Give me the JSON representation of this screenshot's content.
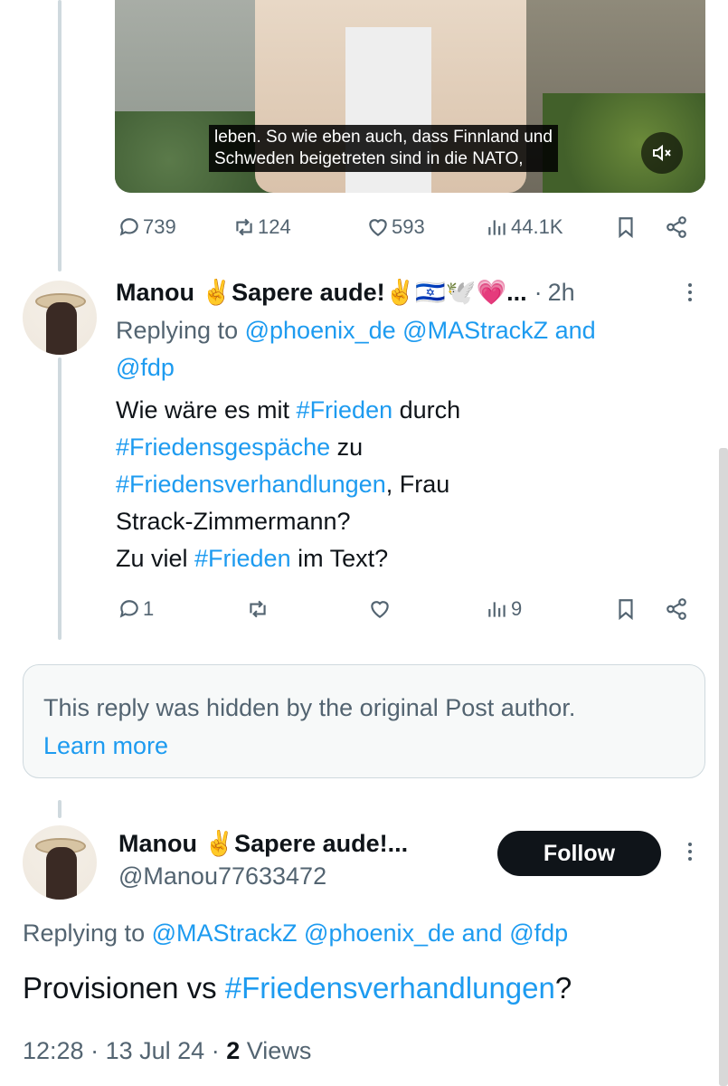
{
  "video": {
    "subtitle_line1": "leben. So wie eben auch, dass Finnland und",
    "subtitle_line2": "Schweden beigetreten sind in die NATO,"
  },
  "main_post_actions": {
    "replies": "739",
    "reposts": "124",
    "likes": "593",
    "views": "44.1K"
  },
  "reply1": {
    "display_name": "Manou ✌️Sapere aude!✌️🇮🇱🕊️💗...",
    "separator": "·",
    "time": "2h",
    "replying_prefix": "Replying to",
    "mention1": "@phoenix_de",
    "mention2": "@MAStrackZ",
    "and_word": "and",
    "mention3": "@fdp",
    "t1": "Wie wäre es mit ",
    "h1": "#Frieden",
    "t2": " durch",
    "h2": "#Friedensgespäche",
    "t3": " zu",
    "h3": "#Friedensverhandlungen",
    "t4": ", Frau",
    "t5": "Strack-Zimmermann?",
    "t6": "Zu viel ",
    "h4": "#Frieden",
    "t7": " im Text?",
    "actions": {
      "replies": "1",
      "views": "9"
    }
  },
  "hidden_notice": {
    "text": "This reply was hidden by the original Post author.",
    "link": "Learn more"
  },
  "reply2": {
    "display_name": "Manou ✌️Sapere aude!...",
    "handle": "@Manou77633472",
    "follow_label": "Follow",
    "replying_prefix": "Replying to",
    "mention1": "@MAStrackZ",
    "mention2": "@phoenix_de",
    "and_word": "and",
    "mention3": "@fdp",
    "t1": "Provisionen vs ",
    "h1": "#Friedensverhandlungen",
    "t2": "?",
    "time": "12:28",
    "sep1": "·",
    "date": "13 Jul 24",
    "sep2": "·",
    "views_count": "2",
    "views_label": "Views"
  },
  "colors": {
    "accent": "#1d9bf0",
    "muted": "#536471",
    "text": "#0f1419"
  }
}
